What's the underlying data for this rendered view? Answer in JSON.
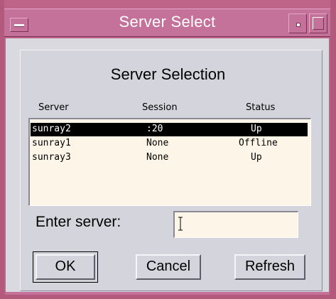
{
  "window": {
    "title": "Server Select"
  },
  "dialog": {
    "heading": "Server Selection",
    "columns": [
      "Server",
      "Session",
      "Status"
    ],
    "servers": [
      {
        "server": "sunray2",
        "session": ":20",
        "status": "Up",
        "selected": true
      },
      {
        "server": "sunray1",
        "session": "None",
        "status": "Offline",
        "selected": false
      },
      {
        "server": "sunray3",
        "session": "None",
        "status": "Up",
        "selected": false
      }
    ],
    "enter_label": "Enter server:",
    "enter_value": "",
    "buttons": {
      "ok": "OK",
      "cancel": "Cancel",
      "refresh": "Refresh"
    }
  },
  "colors": {
    "frame": "#b35a7c",
    "titlebar": "#c4729a",
    "dialog_bg": "#d4d4dc",
    "list_bg": "#fdf6e8",
    "selection": "#000000"
  }
}
